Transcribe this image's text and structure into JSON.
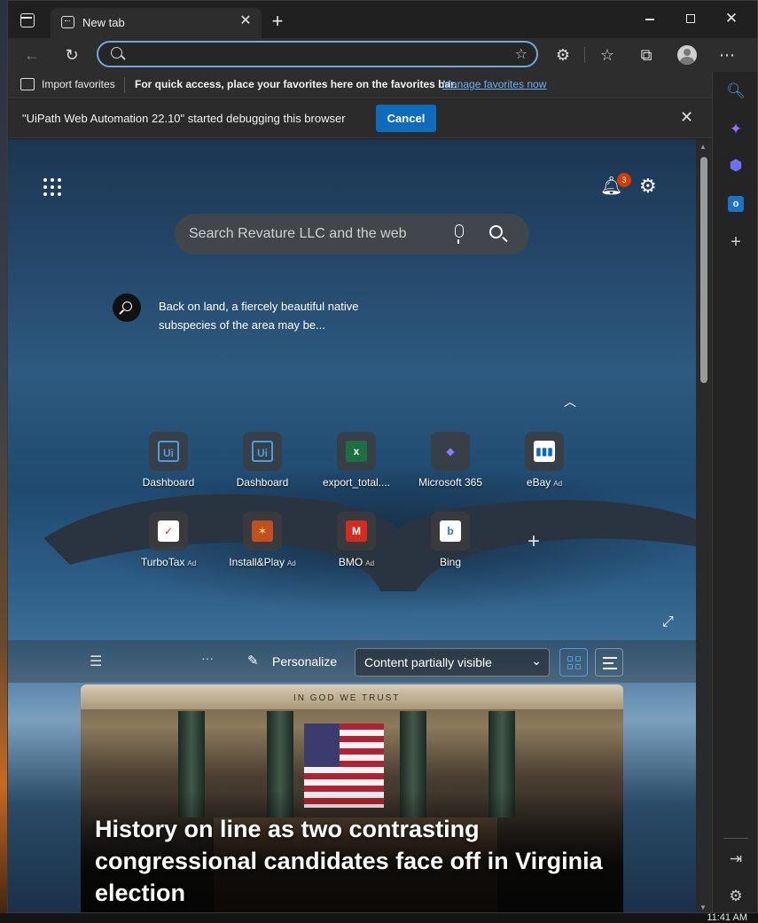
{
  "tab": {
    "title": "New tab"
  },
  "address_bar": {
    "value": "",
    "placeholder": ""
  },
  "favorites_bar": {
    "import_label": "Import favorites",
    "message": "For quick access, place your favorites here on the favorites bar.",
    "link": "Manage favorites now"
  },
  "debug_bar": {
    "message": "\"UiPath Web Automation 22.10\" started debugging this browser",
    "cancel_label": "Cancel"
  },
  "newtab": {
    "notification_count": "3",
    "search_placeholder": "Search Revature LLC and the web",
    "image_caption": "Back on land, a fiercely beautiful native subspecies of the area may be...",
    "ad_tag": "Ad",
    "tiles": [
      {
        "label": "Dashboard",
        "icon": "uipath-icon",
        "ad": false
      },
      {
        "label": "Dashboard",
        "icon": "uipath-icon",
        "ad": false
      },
      {
        "label": "export_total....",
        "icon": "excel-icon",
        "ad": false
      },
      {
        "label": "Microsoft 365",
        "icon": "microsoft-365-icon",
        "ad": false
      },
      {
        "label": "eBay",
        "icon": "ebay-bag-icon",
        "ad": true
      },
      {
        "label": "TurboTax",
        "icon": "turbotax-icon",
        "ad": true
      },
      {
        "label": "Install&Play",
        "icon": "game-icon",
        "ad": true
      },
      {
        "label": "BMO",
        "icon": "bmo-icon",
        "ad": true
      },
      {
        "label": "Bing",
        "icon": "bing-icon",
        "ad": false
      }
    ],
    "feed": {
      "personalize_label": "Personalize",
      "visibility_value": "Content partially visible"
    },
    "news": {
      "banner_text": "IN GOD WE TRUST",
      "headline": "History on line as two contrasting congressional candidates face off in Virginia election"
    }
  },
  "taskbar": {
    "time": "11:41 AM"
  },
  "colors": {
    "accent": "#0f6cbd",
    "link": "#6ab0f3",
    "badge": "#d83b01"
  }
}
